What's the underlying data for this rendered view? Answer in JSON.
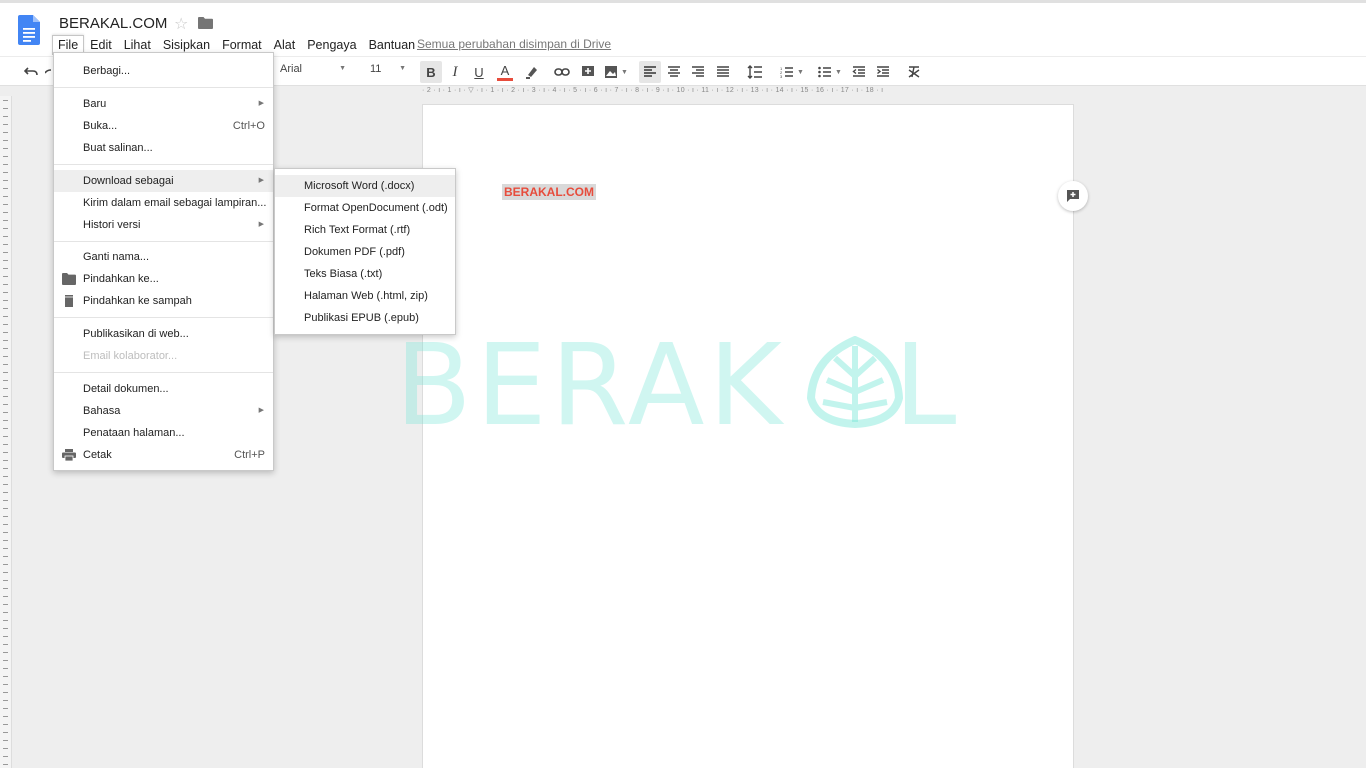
{
  "header": {
    "doc_title": "BERAKAL.COM",
    "saved_status": "Semua perubahan disimpan di Drive"
  },
  "menubar": {
    "items": [
      "File",
      "Edit",
      "Lihat",
      "Sisipkan",
      "Format",
      "Alat",
      "Pengaya",
      "Bantuan"
    ]
  },
  "toolbar": {
    "font": "Arial",
    "font_size": "11",
    "bold_label": "B",
    "italic_label": "I",
    "underline_label": "U",
    "text_color_label": "A"
  },
  "ruler": {
    "text": "· 2 · ı · 1 · ı · ▽ · ı · 1 · ı · 2 · ı · 3 · ı · 4 · ı · 5 · ı · 6 · ı · 7 · ı · 8 · ı · 9 · ı · 10 · ı · 11 · ı · 12 · ı · 13 · ı · 14 · ı · 15 · 16 · ı · 17 · ı · 18 · ı"
  },
  "document": {
    "text": "BERAKAL.COM"
  },
  "watermark": {
    "text": "BERAK",
    "text_end": "L"
  },
  "file_menu": {
    "share": "Berbagi...",
    "new": "Baru",
    "open": "Buka...",
    "open_shortcut": "Ctrl+O",
    "copy": "Buat salinan...",
    "download_as": "Download sebagai",
    "email_attachment": "Kirim dalam email sebagai lampiran...",
    "version_history": "Histori versi",
    "rename": "Ganti nama...",
    "move_to": "Pindahkan ke...",
    "move_to_trash": "Pindahkan ke sampah",
    "publish_web": "Publikasikan di web...",
    "email_collaborators": "Email kolaborator...",
    "doc_details": "Detail dokumen...",
    "language": "Bahasa",
    "page_setup": "Penataan halaman...",
    "print": "Cetak",
    "print_shortcut": "Ctrl+P"
  },
  "download_submenu": {
    "items": [
      "Microsoft Word (.docx)",
      "Format OpenDocument (.odt)",
      "Rich Text Format (.rtf)",
      "Dokumen PDF (.pdf)",
      "Teks Biasa (.txt)",
      "Halaman Web (.html, zip)",
      "Publikasi EPUB (.epub)"
    ]
  },
  "colors": {
    "doc_blue": "#4285f4",
    "highlight_red": "#e74c3c",
    "watermark": "#78e6d7"
  }
}
